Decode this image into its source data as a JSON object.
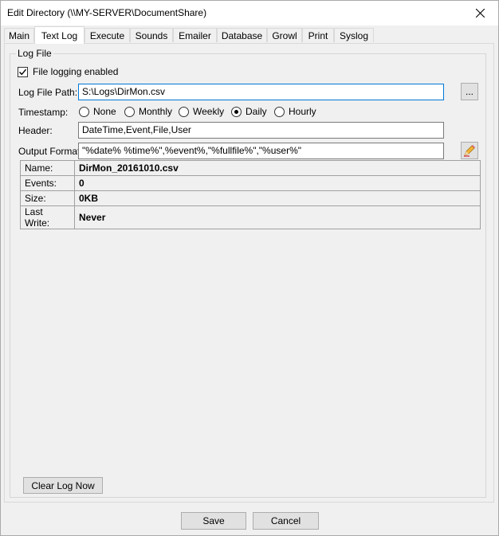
{
  "window": {
    "title": "Edit Directory (\\\\MY-SERVER\\DocumentShare)",
    "close_icon": "close-icon"
  },
  "tabs": [
    {
      "label": "Main"
    },
    {
      "label": "Text Log",
      "active": true
    },
    {
      "label": "Execute"
    },
    {
      "label": "Sounds"
    },
    {
      "label": "Emailer"
    },
    {
      "label": "Database"
    },
    {
      "label": "Growl"
    },
    {
      "label": "Print"
    },
    {
      "label": "Syslog"
    }
  ],
  "log_file": {
    "group_label": "Log File",
    "logging_enabled_label": "File logging enabled",
    "logging_enabled": true,
    "path_label": "Log File Path:",
    "path_value": "S:\\Logs\\DirMon.csv",
    "browse_label": "...",
    "timestamp_label": "Timestamp:",
    "timestamp_options": [
      "None",
      "Monthly",
      "Weekly",
      "Daily",
      "Hourly"
    ],
    "timestamp_selected": "Daily",
    "header_label": "Header:",
    "header_value": "DateTime,Event,File,User",
    "output_format_label": "Output Format:",
    "output_format_value": "\"%date% %time%\",%event%,\"%fullfile%\",\"%user%\"",
    "edit_icon": "pencil-eraser-icon"
  },
  "info": [
    {
      "key": "Name:",
      "value": "DirMon_20161010.csv"
    },
    {
      "key": "Events:",
      "value": "0"
    },
    {
      "key": "Size:",
      "value": "0KB"
    },
    {
      "key": "Last Write:",
      "value": "Never"
    }
  ],
  "clear_log_label": "Clear Log Now",
  "footer": {
    "save_label": "Save",
    "cancel_label": "Cancel"
  }
}
